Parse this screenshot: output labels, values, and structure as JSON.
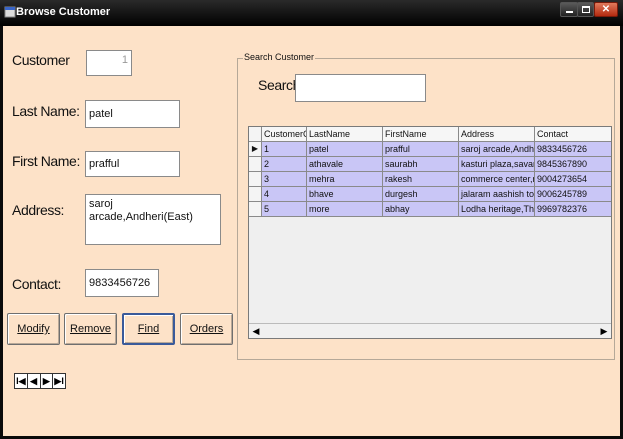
{
  "window": {
    "title": "Browse Customer"
  },
  "form": {
    "customer_label": "Customer",
    "customer_value": "1",
    "lastname_label": "Last Name:",
    "lastname_value": "patel",
    "firstname_label": "First Name:",
    "firstname_value": "prafful",
    "address_label": "Address:",
    "address_value": "saroj arcade,Andheri(East)",
    "contact_label": "Contact:",
    "contact_value": "9833456726"
  },
  "buttons": {
    "modify": "Modify",
    "remove": "Remove",
    "find": "Find",
    "orders": "Orders"
  },
  "navigator": {
    "first": "I◀",
    "prev": "◀",
    "next": "▶",
    "last": "▶I"
  },
  "search": {
    "group_label": "Search Customer",
    "label": "Search:",
    "value": ""
  },
  "grid": {
    "columns": [
      "CustomerCode",
      "LastName",
      "FirstName",
      "Address",
      "Contact"
    ],
    "rows": [
      [
        "1",
        "patel",
        "prafful",
        "saroj arcade,Andheri(East)",
        "9833456726"
      ],
      [
        "2",
        "athavale",
        "saurabh",
        "kasturi plaza,savarkar m",
        "9845367890"
      ],
      [
        "3",
        "mehra",
        "rakesh",
        "commerce center,near s",
        "9004273654"
      ],
      [
        "4",
        "bhave",
        "durgesh",
        "jalaram aashish towers,r",
        "9006245789"
      ],
      [
        "5",
        "more",
        "abhay",
        "Lodha heritage,Thane(W",
        "9969782376"
      ]
    ]
  },
  "colors": {
    "form_bg": "#fde2c8",
    "row_bg": "#c9c6f6",
    "titlebar": "#000000"
  }
}
